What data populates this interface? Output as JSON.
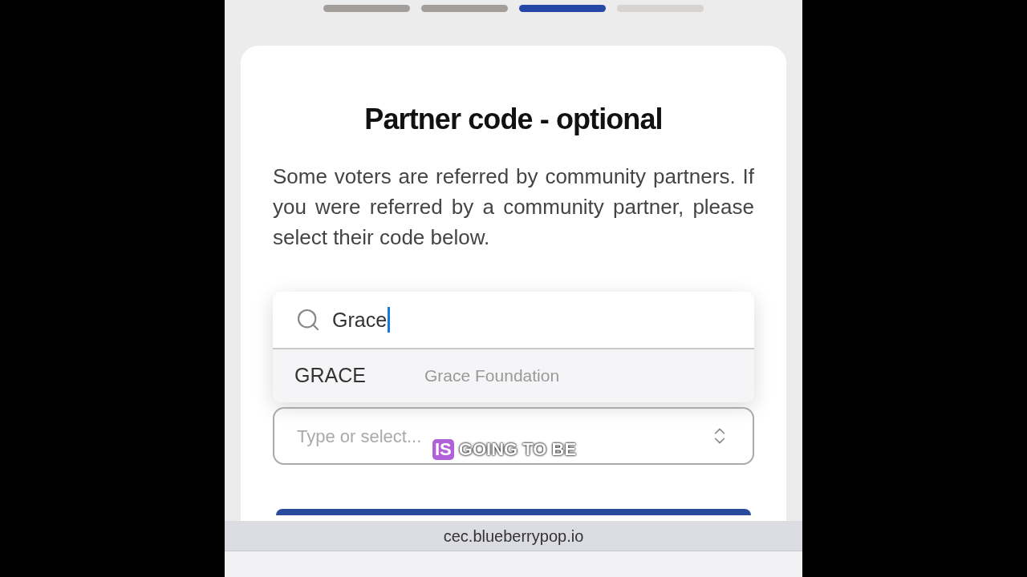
{
  "steps": [
    {
      "completed": true,
      "selected": false
    },
    {
      "completed": true,
      "selected": false
    },
    {
      "completed": false,
      "selected": true
    },
    {
      "completed": false,
      "selected": false
    }
  ],
  "title": "Partner code - optional",
  "description": "Some voters are referred by community partners. If you were referred by a community partner, please select their code below.",
  "dropdown": {
    "search_value": "Grace",
    "options": [
      {
        "code": "GRACE",
        "name": "Grace Foundation"
      }
    ]
  },
  "select": {
    "placeholder": "Type or select..."
  },
  "caption": {
    "highlight": "IS",
    "rest": "GOING TO BE"
  },
  "url": "cec.blueberrypop.io"
}
